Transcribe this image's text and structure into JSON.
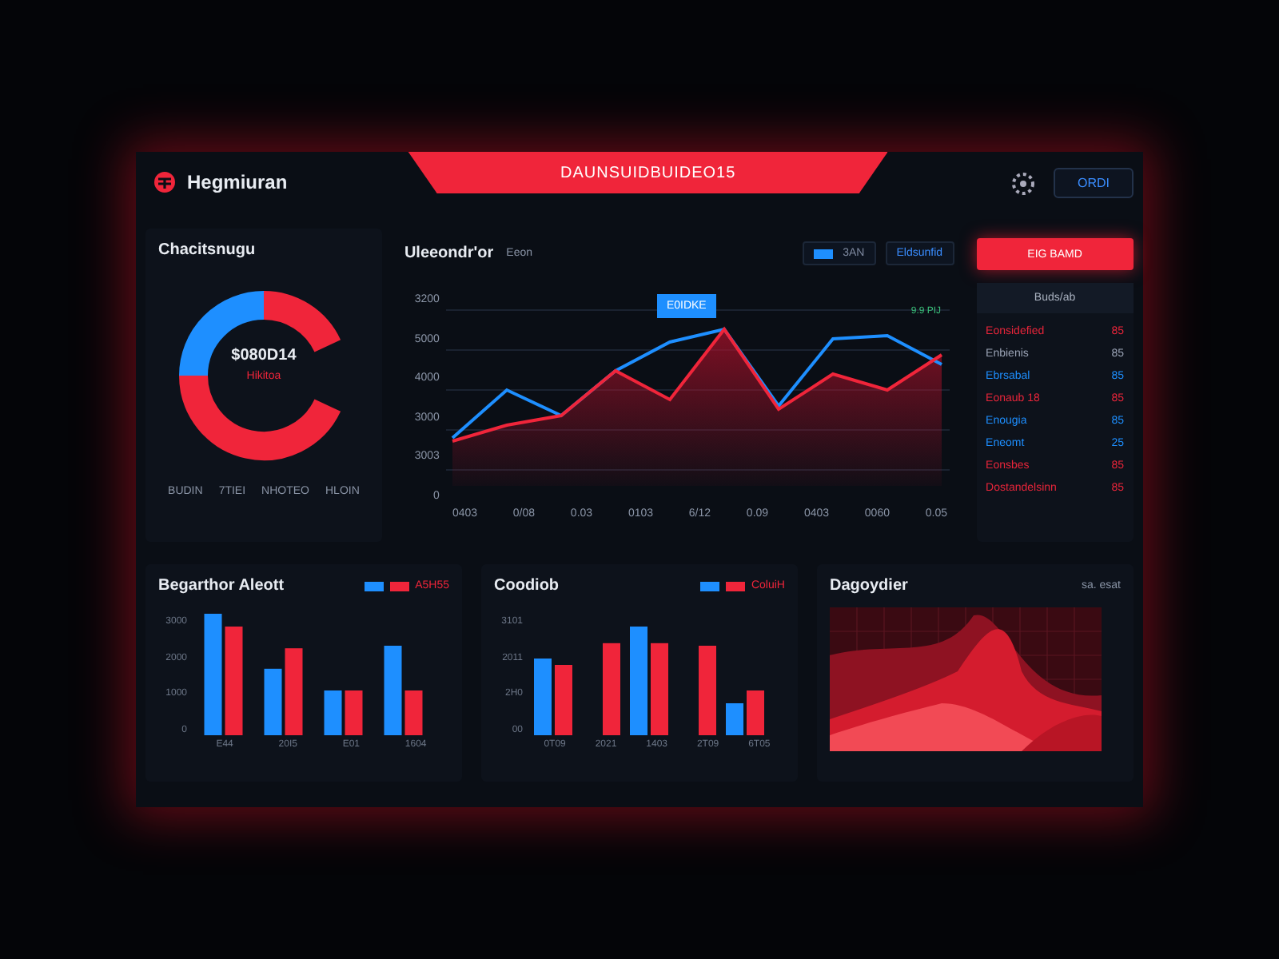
{
  "header": {
    "brand": "Hegmiuran",
    "banner": "DAUNSUIDBUIDEO15",
    "button": "ORDI"
  },
  "donut_card": {
    "title": "Chacitsnugu",
    "center_value": "$080D14",
    "center_label": "Hikitoa",
    "legend": [
      "BUDIN",
      "7TIEI",
      "NHOTEO",
      "HLOIN"
    ]
  },
  "line_card": {
    "title": "Uleeondr'or",
    "subtitle": "Eeon",
    "toggle": "3AN",
    "button": "Eldsunfid",
    "tooltip": "E0IDKE",
    "legend": "9.9 PIJ",
    "y_labels": [
      "3200",
      "5000",
      "4000",
      "3000",
      "3003",
      "0"
    ],
    "x_labels": [
      "0403",
      "0/08",
      "0.03",
      "0103",
      "6/12",
      "0.09",
      "0403",
      "0060",
      "0.05"
    ]
  },
  "side": {
    "button": "EIG BAMD",
    "list_title": "Buds/ab",
    "items": [
      {
        "name": "Eonsidefied",
        "value": "85",
        "color": "#e8253a"
      },
      {
        "name": "Enbienis",
        "value": "85",
        "color": "#9aa3b5"
      },
      {
        "name": "Ebrsabal",
        "value": "85",
        "color": "#1e8fff"
      },
      {
        "name": "Eonaub 18",
        "value": "85",
        "color": "#e8253a"
      },
      {
        "name": "Enougia",
        "value": "85",
        "color": "#1e8fff"
      },
      {
        "name": "Eneomt",
        "value": "25",
        "color": "#1e8fff"
      },
      {
        "name": "Eonsbes",
        "value": "85",
        "color": "#e8253a"
      },
      {
        "name": "Dostandelsinn",
        "value": "85",
        "color": "#e8253a"
      }
    ]
  },
  "bar_card_1": {
    "title": "Begarthor Aleott",
    "legend": "A5H55",
    "y_labels": [
      "3000",
      "2000",
      "1000",
      "0"
    ],
    "x_labels": [
      "E44",
      "20I5",
      "E01",
      "1604"
    ]
  },
  "bar_card_2": {
    "title": "Coodiob",
    "legend": "ColuiH",
    "y_labels": [
      "3101",
      "2011",
      "2H0",
      "00"
    ],
    "x_labels": [
      "0T09",
      "2021",
      "1403",
      "2T09",
      "6T05"
    ]
  },
  "area_card": {
    "title": "Dagoydier",
    "legend": "sa. esat"
  }
}
